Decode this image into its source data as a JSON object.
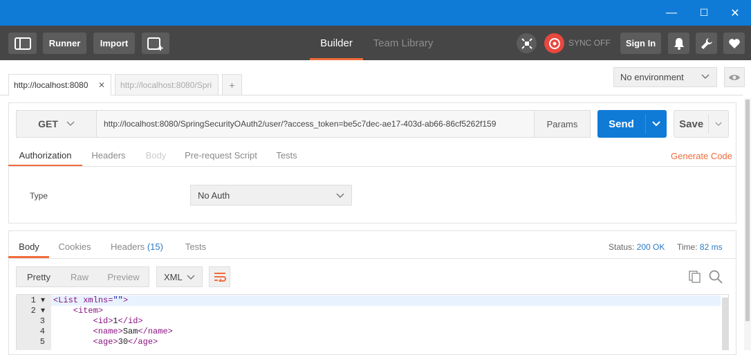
{
  "window": {
    "minimize_glyph": "—",
    "maximize_glyph": "☐",
    "close_glyph": "✕"
  },
  "toolbar": {
    "runner": "Runner",
    "import": "Import",
    "builder": "Builder",
    "team_library": "Team Library",
    "sync": "SYNC OFF",
    "sign_in": "Sign In"
  },
  "tabs": [
    {
      "label": "http://localhost:8080",
      "close": "✕"
    },
    {
      "label": "http://localhost:8080/Spri"
    }
  ],
  "add_tab": "+",
  "environment": "No environment",
  "request": {
    "method": "GET",
    "url": "http://localhost:8080/SpringSecurityOAuth2/user/?access_token=be5c7dec-ae17-403d-ab66-86cf5262f159",
    "params": "Params",
    "send": "Send",
    "save": "Save"
  },
  "request_tabs": [
    "Authorization",
    "Headers",
    "Body",
    "Pre-request Script",
    "Tests"
  ],
  "generate_code": "Generate Code",
  "auth": {
    "type_label": "Type",
    "type_value": "No Auth"
  },
  "response": {
    "tabs": [
      "Body",
      "Cookies",
      "Headers",
      "Tests"
    ],
    "headers_count": "(15)",
    "status_label": "Status:",
    "status_value": "200 OK",
    "time_label": "Time:",
    "time_value": "82 ms",
    "views": [
      "Pretty",
      "Raw",
      "Preview"
    ],
    "format": "XML"
  },
  "code_lines": [
    {
      "n": "1",
      "fold": "▾",
      "parts": [
        {
          "c": "tag",
          "t": "<List "
        },
        {
          "c": "tag",
          "t": "xmlns="
        },
        {
          "c": "str",
          "t": "\"\""
        },
        {
          "c": "tag",
          "t": ">"
        }
      ]
    },
    {
      "n": "2",
      "fold": "▾",
      "parts": [
        {
          "c": "tag",
          "t": "    <item>"
        }
      ]
    },
    {
      "n": "3",
      "fold": "",
      "parts": [
        {
          "c": "tag",
          "t": "        <id>"
        },
        {
          "c": "txt",
          "t": "1"
        },
        {
          "c": "tag",
          "t": "</id>"
        }
      ]
    },
    {
      "n": "4",
      "fold": "",
      "parts": [
        {
          "c": "tag",
          "t": "        <name>"
        },
        {
          "c": "txt",
          "t": "Sam"
        },
        {
          "c": "tag",
          "t": "</name>"
        }
      ]
    },
    {
      "n": "5",
      "fold": "",
      "parts": [
        {
          "c": "tag",
          "t": "        <age>"
        },
        {
          "c": "txt",
          "t": "30"
        },
        {
          "c": "tag",
          "t": "</age>"
        }
      ]
    }
  ],
  "colors": {
    "titlebar": "#0f7bd7",
    "toolbar": "#464646",
    "accent_orange": "#f26b3a",
    "send_blue": "#0f7bd7",
    "link_blue": "#2a7ac5"
  }
}
